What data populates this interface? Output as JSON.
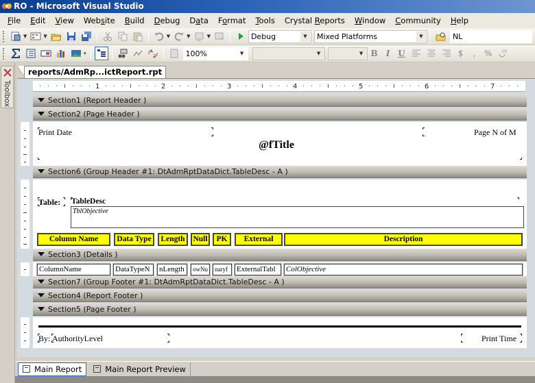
{
  "window": {
    "title": "RO - Microsoft Visual Studio"
  },
  "menu": {
    "items": [
      {
        "label": "File",
        "accel": "F"
      },
      {
        "label": "Edit",
        "accel": "E"
      },
      {
        "label": "View",
        "accel": "V"
      },
      {
        "label": "Website",
        "accel": "s"
      },
      {
        "label": "Build",
        "accel": "B"
      },
      {
        "label": "Debug",
        "accel": "D"
      },
      {
        "label": "Data",
        "accel": "a"
      },
      {
        "label": "Format",
        "accel": "o"
      },
      {
        "label": "Tools",
        "accel": "T"
      },
      {
        "label": "Crystal Reports",
        "accel": "R"
      },
      {
        "label": "Window",
        "accel": "W"
      },
      {
        "label": "Community",
        "accel": "C"
      },
      {
        "label": "Help",
        "accel": "H"
      }
    ]
  },
  "toolbar1": {
    "config_value": "Debug",
    "platform_value": "Mixed Platforms",
    "find_value": "NL"
  },
  "toolbar2": {
    "zoom_value": "100%",
    "font_value": "",
    "size_value": "",
    "bold": "B",
    "italic": "I",
    "underline": "U",
    "currency": "$",
    "comma": ",",
    "percent": "%"
  },
  "toolbox": {
    "label": "Toolbox"
  },
  "document_tab": {
    "label": "reports/AdmRp...ictReport.rpt"
  },
  "ruler": {
    "marks": [
      "1",
      "2",
      "3",
      "4",
      "5",
      "6",
      "7"
    ]
  },
  "sections": {
    "s1": "Section1 (Report Header  )",
    "s2": "Section2 (Page Header  )",
    "s6": "Section6 (Group Header #1: DtAdmRptDataDict.TableDesc - A )",
    "s3": "Section3 (Details  )",
    "s7": "Section7 (Group Footer #1: DtAdmRptDataDict.TableDesc - A )",
    "s4": "Section4 (Report Footer  )",
    "s5": "Section5 (Page Footer  )"
  },
  "page_header": {
    "print_date": "Print Date",
    "title_formula": "@fTitle",
    "page_n_of_m": "Page N of M"
  },
  "group_header": {
    "table_label": "Table:",
    "table_desc": "TableDesc",
    "tbl_objective": "TblObjective",
    "column_headers": [
      "Column Name",
      "Data Type",
      "Length",
      "Null",
      "PK",
      "External",
      "Description"
    ]
  },
  "details": {
    "fields": [
      "ColumnName",
      "DataTypeN",
      "nLength",
      "owNu",
      "naryf",
      "ExternalTabl",
      "ColObjective"
    ]
  },
  "page_footer": {
    "by_label": "By:",
    "authority_level": "AuthorityLevel",
    "print_time": "Print Time"
  },
  "bottom_tabs": {
    "main_report": "Main Report",
    "main_report_preview": "Main Report Preview"
  },
  "colors": {
    "header_fill": "#ffff00",
    "title_gradient_start": "#0a3d8f",
    "designer_bg": "#d4dbe0"
  }
}
